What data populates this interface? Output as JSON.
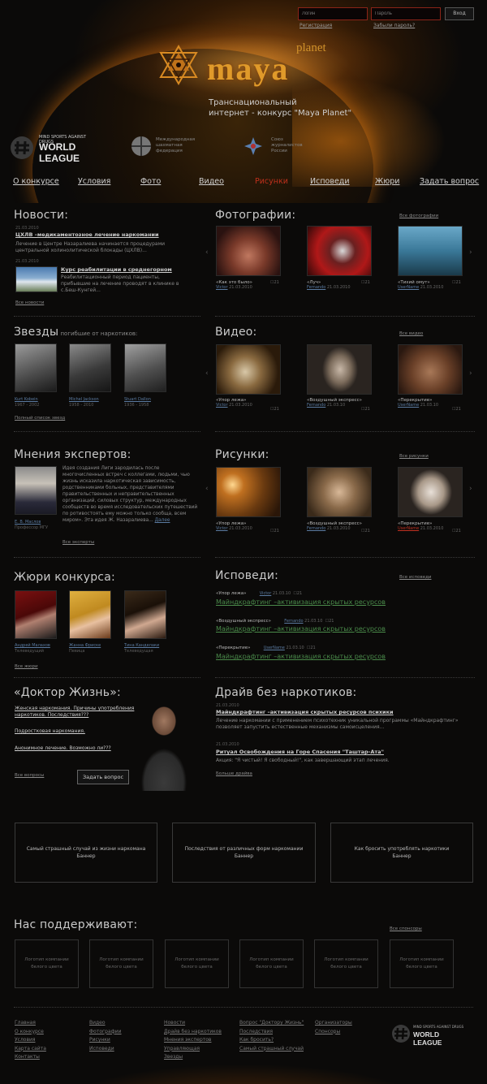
{
  "login": {
    "login_placeholder": "Логин",
    "password_placeholder": "Пароль",
    "submit": "Вход",
    "register": "Регистрация",
    "forgot": "Забыли пароль?"
  },
  "brand": {
    "planet": "planet",
    "maya": "maya",
    "tagline_1": "Транснациональный",
    "tagline_2": "интернет - конкурс \"Maya Planet\""
  },
  "partners": [
    {
      "line1": "WORLD LEAGUE",
      "line2": "MIND SPORTS AGAINST DRUGS"
    },
    {
      "line1": "Международная",
      "line2": "шахматная",
      "line3": "федерация"
    },
    {
      "line1": "Союз",
      "line2": "журналистов",
      "line3": "России"
    }
  ],
  "nav": [
    "О конкурсе",
    "Условия",
    "Фото",
    "Видео",
    "Рисунки",
    "Исповеди",
    "Жюри",
    "Задать вопрос"
  ],
  "news": {
    "title": "Новости:",
    "items": [
      {
        "date": "21.03.2010",
        "headline": "ЦХЛВ –медикаментозное лечение наркомании",
        "text": "Лечение в Центре Назаралиева начинается процедурами центральной холинолитической блокады (ЦХЛВ)..."
      },
      {
        "date": "21.03.2010",
        "headline": "Курс реабилитации в среднегорном",
        "text": "Реабилитационный период пациенты, прибывшие на лечение проводят в клинике в с.Беш-Кунгей..."
      }
    ],
    "all": "Все новости"
  },
  "stars": {
    "title": "Звезды",
    "subtitle": "погибшие от наркотиков:",
    "items": [
      {
        "name": "Kurt Kobein",
        "years": "1967 - 2002"
      },
      {
        "name": "Michel Jackson",
        "years": "1958 - 2010"
      },
      {
        "name": "Stuart Dallon",
        "years": "1936 - 1958"
      }
    ],
    "all": "Полный список звезд"
  },
  "experts": {
    "title": "Мнения экспертов:",
    "name": "Е. В. Маслов",
    "position": "Профессор МГУ",
    "text": "Идея создания Лиги зародилась после многочисленных встреч с коллегами, людьми, чью жизнь исказила наркотическая зависимость, родственниками больных, представителями правительственных и неправительственных организаций, силовых структур, международных сообществ во время исследовательских путешествий по ротивостоять ему можно только сообща, всем миром». Эта идея Ж. Назаралиева...",
    "more": "Далее",
    "all": "Все эксперты"
  },
  "jury": {
    "title": "Жюри конкурса:",
    "items": [
      {
        "name": "Андрей Малахов",
        "role": "Телеведущий"
      },
      {
        "name": "Жанна Фриске",
        "role": "Певица"
      },
      {
        "name": "Тина Канделаки",
        "role": "Телеведущая"
      }
    ],
    "all": "Все жюри"
  },
  "doctor": {
    "title": "«Доктор Жизнь»:",
    "links": [
      "Женская наркомания. Причины употребления наркотиков. Последствия???",
      "Подростковая наркомания.",
      "Анонимное лечение. Возможно ли???"
    ],
    "all": "Все вопросы",
    "ask": "Задать вопрос"
  },
  "photos": {
    "title": "Фотографии:",
    "all": "Все фотографии",
    "items": [
      {
        "caption": "«Как это было»",
        "user": "Victor",
        "date": "21.03.2010",
        "count": "21"
      },
      {
        "caption": "«Луч»",
        "user": "Fernando",
        "date": "21.03.2010",
        "count": "21"
      },
      {
        "caption": "«Тихий омут»",
        "user": "UserName",
        "date": "21.03.2010",
        "count": "21"
      }
    ]
  },
  "videos": {
    "title": "Видео:",
    "all": "Все видео",
    "items": [
      {
        "caption": "«Упор лежа»",
        "user": "Victor",
        "date": "21.03.2010",
        "count": "21"
      },
      {
        "caption": "«Воздушный экспресс»",
        "user": "Fernando",
        "date": "21.03.10",
        "count": "21"
      },
      {
        "caption": "«Перекрытие»",
        "user": "UserName",
        "date": "21.03.10",
        "count": "21"
      }
    ]
  },
  "drawings": {
    "title": "Рисунки:",
    "all": "Все рисунки",
    "items": [
      {
        "caption": "«Упор лежа»",
        "user": "Victor",
        "date": "21.03.2010",
        "count": "21"
      },
      {
        "caption": "«Воздушный экспресс»",
        "user": "Fernando",
        "date": "21.03.2010",
        "count": "21"
      },
      {
        "caption": "«Перекрытие»",
        "user": "UserName",
        "date": "21.03.2010",
        "count": "21"
      }
    ]
  },
  "confessions": {
    "title": "Исповеди:",
    "all": "Все исповеди",
    "items": [
      {
        "caption": "«Упор лежа»",
        "user": "Victor",
        "date": "21.03.10",
        "count": "21",
        "link": "Майндкрафтинг –активизация скрытых ресурсов"
      },
      {
        "caption": "«Воздушный экспресс»",
        "user": "Fernando",
        "date": "21.03.10",
        "count": "21",
        "link": "Майндкрафтинг –активизация скрытых ресурсов"
      },
      {
        "caption": "«Перекрытие»",
        "user": "UserName",
        "date": "21.03.10",
        "count": "21",
        "link": "Майндкрафтинг –активизация скрытых ресурсов"
      }
    ]
  },
  "drive": {
    "title": "Драйв без наркотиков:",
    "items": [
      {
        "date": "21.03.2010",
        "headline": "Майндкрафтинг –активизация скрытых ресурсов психики",
        "text": "Лечение наркомании с применением психотехник уникальной программы «Майндкрафтинг» позволяет запустить естественные механизмы самоисцеления..."
      },
      {
        "date": "21.03.2010",
        "headline": "Ритуал Освобождения на Горе Спасения \"Таштар-Ата\"",
        "text": "Акция: \"Я чистый! Я свободный!\", как завершающий этап лечения."
      }
    ],
    "all": "Больше драйва"
  },
  "banners": [
    {
      "line1": "Самый страшный случай из жизни наркомана",
      "line2": "Баннер"
    },
    {
      "line1": "Последствия от различных форм наркомании",
      "line2": "Баннер"
    },
    {
      "line1": "Как бросить употреблять наркотики",
      "line2": "Баннер"
    }
  ],
  "supporters": {
    "title": "Нас поддерживают:",
    "all": "Все спонсоры",
    "items": [
      {
        "line1": "Логотип компании",
        "line2": "белого цвета"
      },
      {
        "line1": "Логотип компании",
        "line2": "белого цвета"
      },
      {
        "line1": "Логотип компании",
        "line2": "белого цвета"
      },
      {
        "line1": "Логотип компании",
        "line2": "белого цвета"
      },
      {
        "line1": "Логотип компании",
        "line2": "белого цвета"
      },
      {
        "line1": "Логотип компании",
        "line2": "белого цвета"
      }
    ]
  },
  "footer": {
    "col1": [
      "Главная",
      "О конкурсе",
      "Условия",
      "Карта сайта",
      "Контакты"
    ],
    "col2": [
      "Видео",
      "Фотографии",
      "Рисунки",
      "Исповеди"
    ],
    "col3": [
      "Новости",
      "Драйв без наркотиков",
      "Мнения экспертов",
      "Управляющая",
      "Звезды"
    ],
    "col4": [
      "Вопрос \"Доктору Жизнь\"",
      "Последствия",
      "Как бросить?",
      "Самый страшный случай"
    ],
    "col5": [
      "Организаторы",
      "Спонсоры"
    ],
    "logo_line1": "WORLD LEAGUE",
    "logo_line2": "MIND SPORTS AGAINST DRUGS"
  }
}
